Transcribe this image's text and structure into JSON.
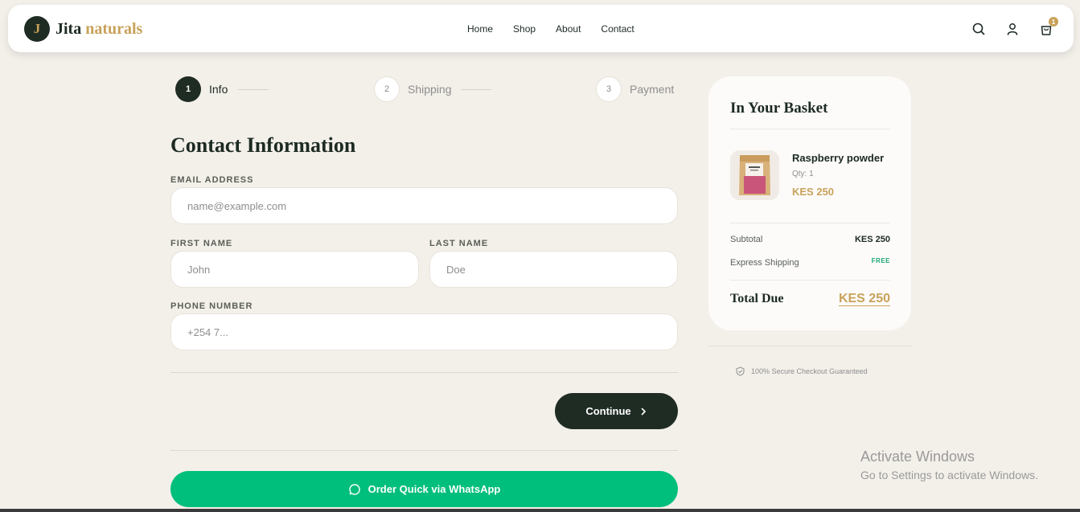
{
  "header": {
    "logo_letter": "J",
    "logo_name_1": "Jita",
    "logo_name_2": "naturals",
    "nav": [
      "Home",
      "Shop",
      "About",
      "Contact"
    ],
    "cart_count": "1",
    "icons": [
      "search-icon",
      "user-icon",
      "cart-icon"
    ]
  },
  "stepper": {
    "steps": [
      {
        "num": "1",
        "label": "Info"
      },
      {
        "num": "2",
        "label": "Shipping"
      },
      {
        "num": "3",
        "label": "Payment"
      }
    ]
  },
  "form": {
    "title": "Contact Information",
    "email_label": "EMAIL ADDRESS",
    "email_placeholder": "name@example.com",
    "first_label": "FIRST NAME",
    "first_placeholder": "John",
    "last_label": "LAST NAME",
    "last_placeholder": "Doe",
    "phone_label": "PHONE NUMBER",
    "phone_placeholder": "+254 7...",
    "continue_label": "Continue",
    "whatsapp_label": "Order Quick via WhatsApp"
  },
  "basket": {
    "title": "In Your Basket",
    "item": {
      "name": "Raspberry powder",
      "qty": "Qty: 1",
      "price": "KES 250"
    },
    "subtotal_label": "Subtotal",
    "subtotal_value": "KES 250",
    "shipping_label": "Express Shipping",
    "shipping_value": "FREE",
    "total_label": "Total Due",
    "total_value": "KES 250",
    "secure_text": "100% Secure Checkout Guaranteed"
  },
  "watermark": {
    "line1": "Activate Windows",
    "line2": "Go to Settings to activate Windows."
  },
  "colors": {
    "background": "#f3f0ea",
    "primary_dark": "#1f2c24",
    "accent_gold": "#c8a25a",
    "whatsapp_green": "#00be7c",
    "free_green": "#1aa672"
  }
}
